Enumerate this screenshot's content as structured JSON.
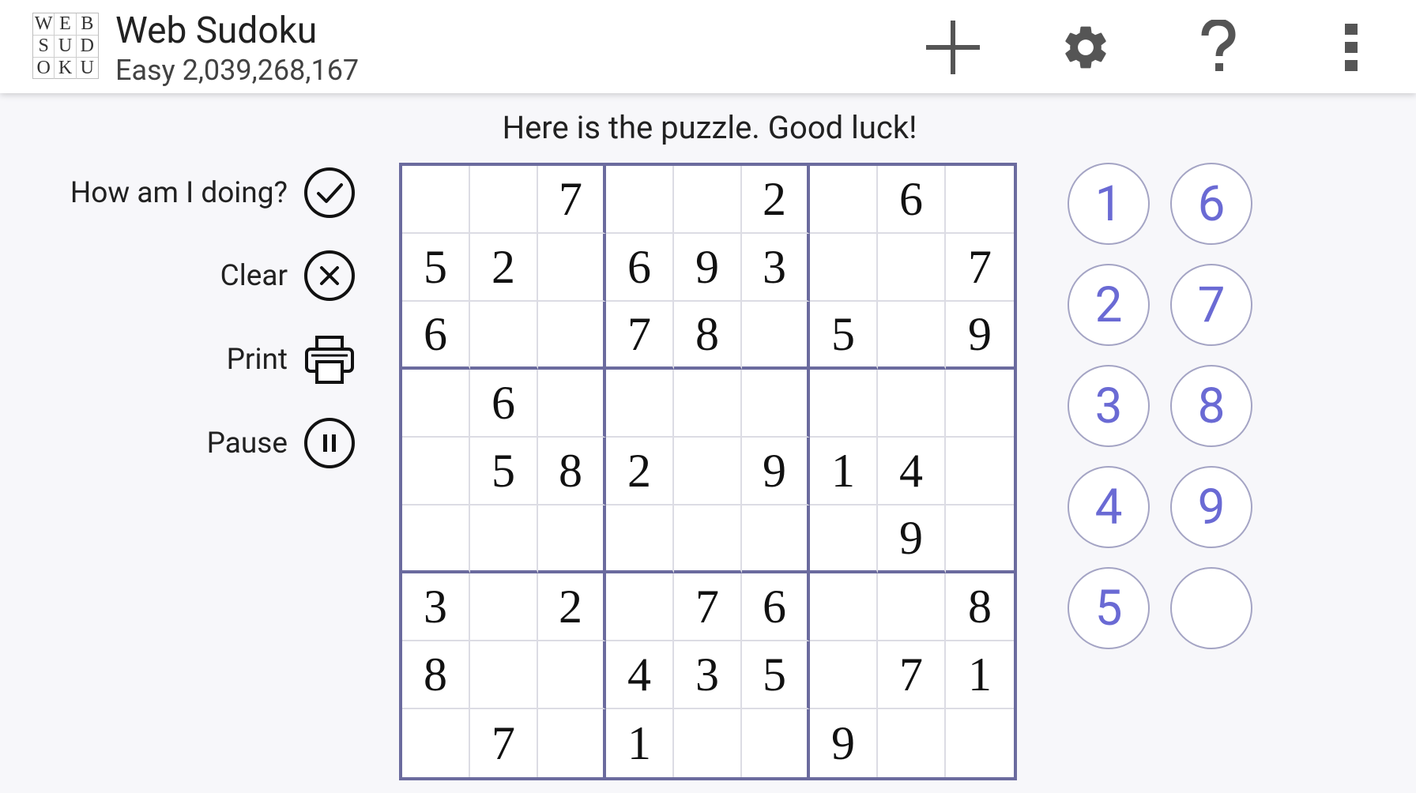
{
  "header": {
    "logo_letters": [
      "W",
      "E",
      "B",
      "S",
      "U",
      "D",
      "O",
      "K",
      "U"
    ],
    "title": "Web Sudoku",
    "subtitle": "Easy 2,039,268,167",
    "icons": [
      "plus-icon",
      "gear-icon",
      "question-mark-icon",
      "overflow-menu-icon"
    ]
  },
  "message": "Here is the puzzle. Good luck!",
  "actions": [
    {
      "label": "How am I doing?",
      "icon": "check-circle-icon"
    },
    {
      "label": "Clear",
      "icon": "x-circle-icon"
    },
    {
      "label": "Print",
      "icon": "printer-icon"
    },
    {
      "label": "Pause",
      "icon": "pause-circle-icon"
    }
  ],
  "grid": [
    [
      "",
      "",
      "7",
      "",
      "",
      "2",
      "",
      "6",
      ""
    ],
    [
      "5",
      "2",
      "",
      "6",
      "9",
      "3",
      "",
      "",
      "7"
    ],
    [
      "6",
      "",
      "",
      "7",
      "8",
      "",
      "5",
      "",
      "9"
    ],
    [
      "",
      "6",
      "",
      "",
      "",
      "",
      "",
      "",
      ""
    ],
    [
      "",
      "5",
      "8",
      "2",
      "",
      "9",
      "1",
      "4",
      ""
    ],
    [
      "",
      "",
      "",
      "",
      "",
      "",
      "",
      "9",
      ""
    ],
    [
      "3",
      "",
      "2",
      "",
      "7",
      "6",
      "",
      "",
      "8"
    ],
    [
      "8",
      "",
      "",
      "4",
      "3",
      "5",
      "",
      "7",
      "1"
    ],
    [
      "",
      "7",
      "",
      "1",
      "",
      "",
      "9",
      "",
      ""
    ]
  ],
  "numpad": [
    "1",
    "6",
    "2",
    "7",
    "3",
    "8",
    "4",
    "9",
    "5",
    ""
  ],
  "colors": {
    "grid_border": "#6b6b9e",
    "numpad_digit": "#6a6ad4",
    "numpad_border": "#a4a4c4"
  }
}
